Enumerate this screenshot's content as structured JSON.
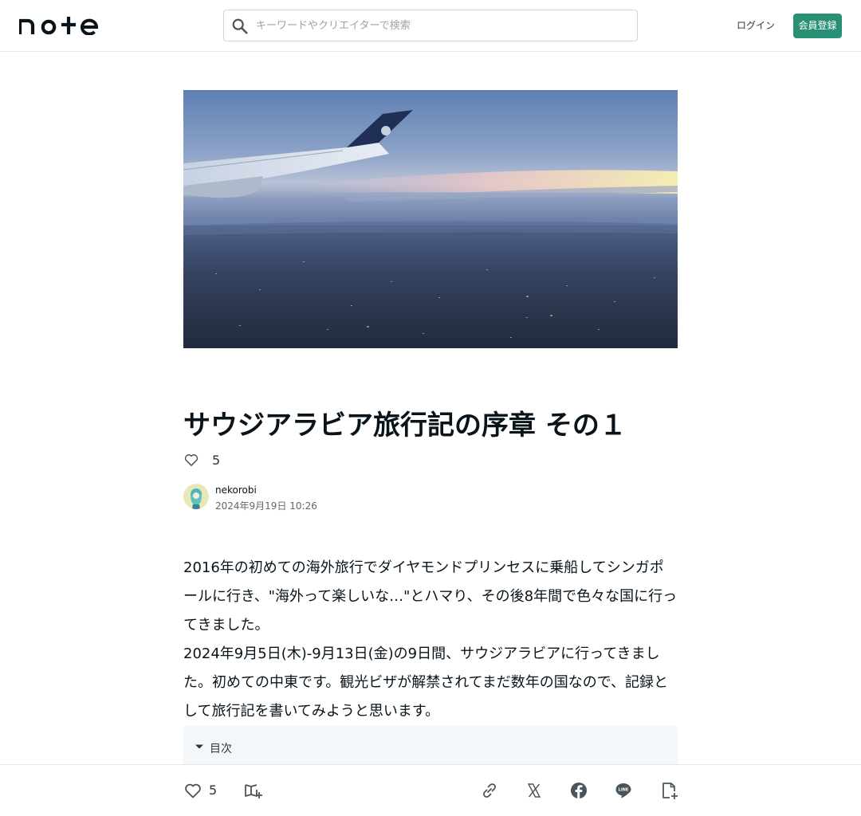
{
  "header": {
    "logo_text": "note",
    "search_placeholder": "キーワードやクリエイターで検索",
    "login_label": "ログイン",
    "signup_label": "会員登録"
  },
  "article": {
    "title": "サウジアラビア旅行記の序章 その１",
    "like_count": "5",
    "author": "nekorobi",
    "date": "2024年9月19日 10:26",
    "paragraphs": [
      "2016年の初めての海外旅行でダイヤモンドプリンセスに乗船してシンガポールに行き、\"海外って楽しいな…\"とハマり、その後8年間で色々な国に行ってきました。",
      "2024年9月5日(木)-9月13日(金)の9日間、サウジアラビアに行ってきました。初めての中東です。観光ビザが解禁されてまだ数年の国なので、記録として旅行記を書いてみようと思います。"
    ],
    "toc_label": "目次"
  },
  "actionbar": {
    "like_count": "5"
  },
  "icons": {
    "search": "search-icon",
    "heart": "heart-icon",
    "magazine_add": "magazine-add-icon",
    "link": "link-icon",
    "x": "x-icon",
    "facebook": "facebook-icon",
    "line": "line-icon",
    "note_add": "note-add-icon",
    "caret": "caret-down-icon"
  },
  "colors": {
    "accent": "#2a9075",
    "text": "#08131a",
    "toc_bg": "#f4f7fa"
  }
}
